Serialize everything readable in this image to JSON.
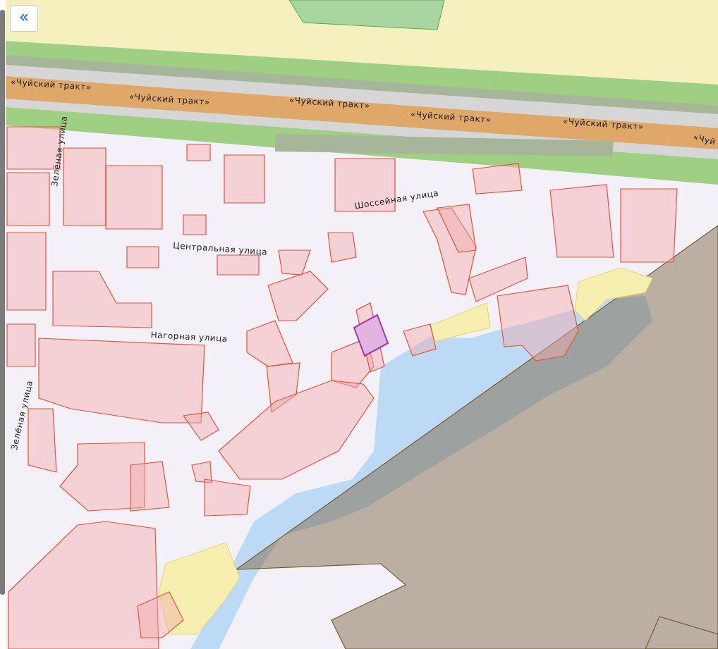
{
  "map": {
    "collapse_button": "«",
    "road_labels": [
      "«Чуйский тракт»",
      "«Чуйский тракт»",
      "«Чуйский тракт»",
      "«Чуйский тракт»",
      "«Чуйский тракт»",
      "«Чуй"
    ],
    "street_labels": [
      "Зелёная улица",
      "Шоссейная улица",
      "Центральная улица",
      "Нагорная улица",
      "Зелёная улица"
    ]
  }
}
